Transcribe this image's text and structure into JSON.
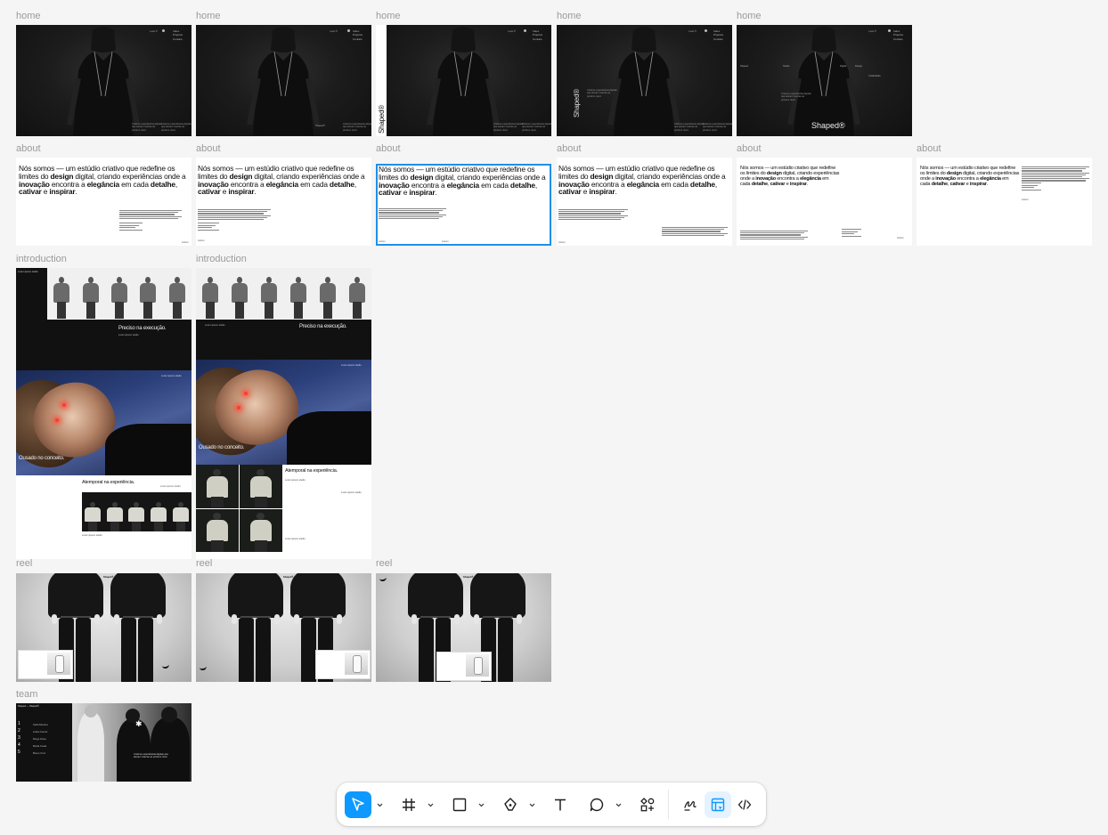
{
  "canvas": {
    "sections": {
      "home": "home",
      "about": "about",
      "introduction": "introduction",
      "reel": "reel",
      "team": "team"
    }
  },
  "home": {
    "nav": [
      "Index",
      "Projetos",
      "Contato"
    ],
    "lets": "Lets ®",
    "logo": "Shaped®",
    "blurb": "Criamos experiências digitais que elevam marcas ao próximo nível.",
    "words": [
      "Shaped",
      "Studio",
      "Digital",
      "Design",
      "Criatividade"
    ]
  },
  "about": {
    "head_parts": {
      "a": "Nós somos — um estúdio criativo que redefine os limites do ",
      "b": "design",
      "c": " digital, criando experiências onde a ",
      "d": "inovação",
      "e": " encontra a ",
      "f": "elegância",
      "g": " em cada ",
      "h": "detalhe",
      "i": ", ",
      "j": "cativar",
      "k": " e ",
      "l": "inspirar",
      "m": "."
    },
    "footer_small": "Lisbon"
  },
  "introduction": {
    "h1": "Preciso na execução.",
    "h2": "Ousado no conceito.",
    "h3": "Atemporal na experiência.",
    "small": "Lorem ipsum studio"
  },
  "reel": {
    "brand": "Shaped®"
  },
  "team": {
    "title": "Shaped — Shaped®",
    "members": [
      {
        "n": "1",
        "name": "Sofia Moreira"
      },
      {
        "n": "2",
        "name": "Andre Ferraz"
      },
      {
        "n": "3",
        "name": "Diogo Alves"
      },
      {
        "n": "4",
        "name": "Marta Costa"
      },
      {
        "n": "5",
        "name": "Bruno Cruz"
      }
    ],
    "star": "✱"
  },
  "toolbar": {
    "tools": [
      {
        "name": "move-tool",
        "icon": "cursor-arrow-icon",
        "active": true
      },
      {
        "name": "frame-tool",
        "icon": "hash-frame-icon"
      },
      {
        "name": "rectangle-tool",
        "icon": "square-icon"
      },
      {
        "name": "pen-tool",
        "icon": "pen-nib-icon"
      },
      {
        "name": "text-tool",
        "icon": "text-T-icon"
      },
      {
        "name": "comment-tool",
        "icon": "speech-bubble-icon"
      },
      {
        "name": "actions-tool",
        "icon": "shapes-plus-icon"
      }
    ],
    "modes": [
      {
        "name": "draw-mode",
        "icon": "scribble-icon"
      },
      {
        "name": "design-mode",
        "icon": "layout-icon",
        "active": true
      },
      {
        "name": "dev-mode",
        "icon": "code-brackets-icon"
      }
    ],
    "accent": "#0d99ff"
  }
}
